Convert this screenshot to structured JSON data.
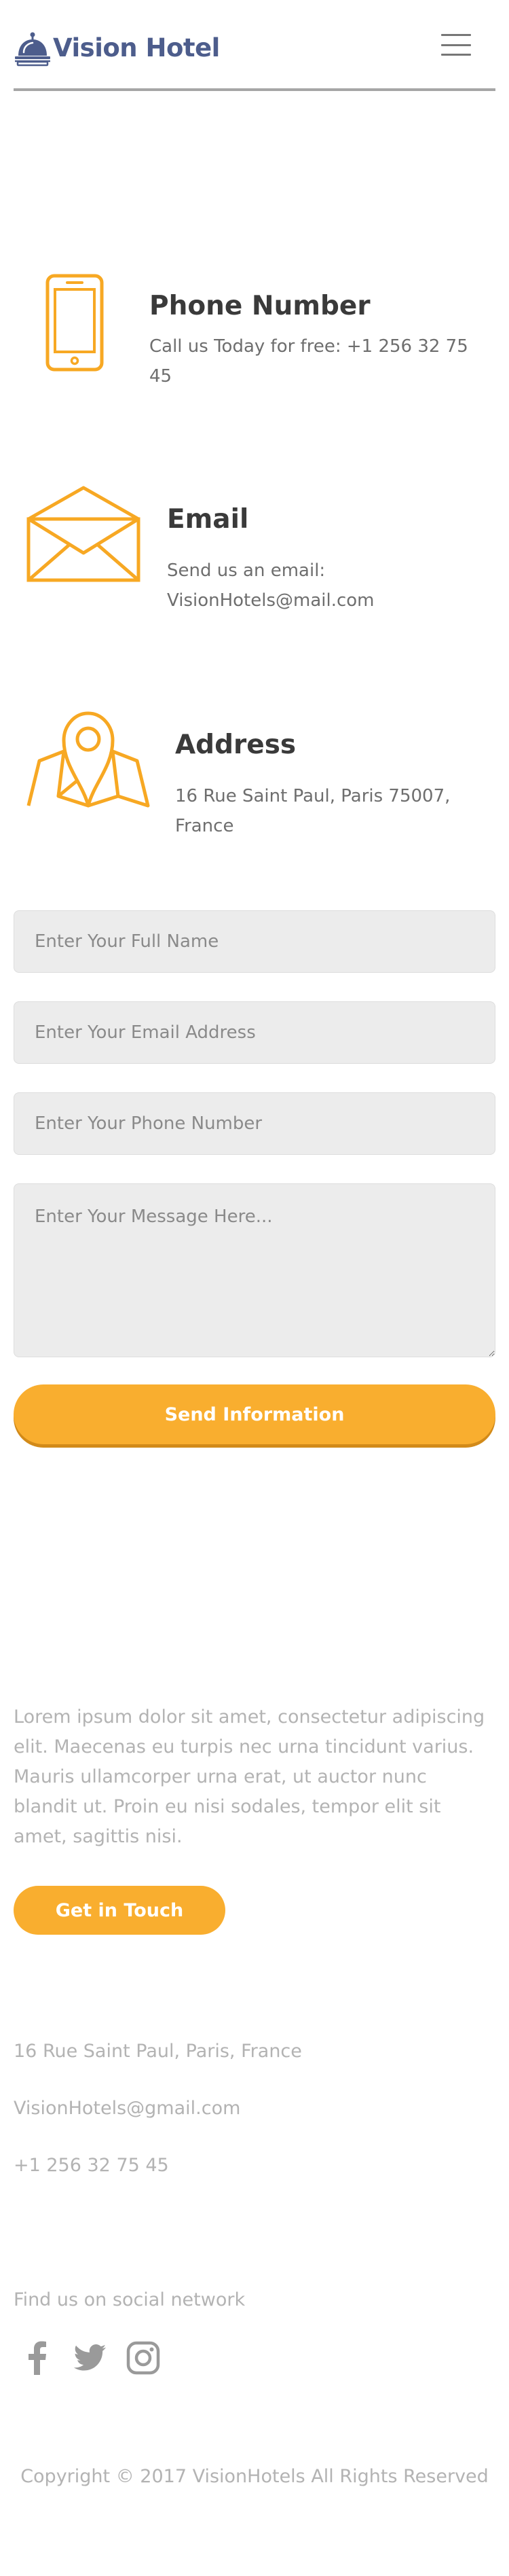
{
  "colors": {
    "brand": "#4d5d8c",
    "accent": "#f9ae2f",
    "heading": "#3a3a3a",
    "muted": "#b3b3b3"
  },
  "header": {
    "logo_text": "Vision Hotel",
    "logo_icon": "service-bell-icon",
    "menu_icon": "hamburger-menu-icon"
  },
  "contact": {
    "phone": {
      "icon": "smartphone-icon",
      "title": "Phone Number",
      "text": "Call us Today for free: +1 256 32 75 45"
    },
    "email": {
      "icon": "envelope-icon",
      "title": "Email",
      "text": "Send us an email: VisionHotels@mail.com"
    },
    "address": {
      "icon": "map-pin-icon",
      "title": "Address",
      "text": "16 Rue Saint Paul, Paris 75007, France"
    }
  },
  "form": {
    "name_placeholder": "Enter Your Full Name",
    "email_placeholder": "Enter Your Email Address",
    "phone_placeholder": "Enter Your Phone Number",
    "message_placeholder": "Enter Your Message Here...",
    "submit_label": "Send Information"
  },
  "footer": {
    "about": "Lorem ipsum dolor sit amet, consectetur adipiscing elit. Maecenas eu turpis nec urna tincidunt varius. Mauris ullamcorper urna erat, ut auctor nunc blandit ut. Proin eu nisi sodales, tempor elit sit amet, sagittis nisi.",
    "touch_label": "Get in Touch",
    "address": "16 Rue Saint Paul, Paris, France",
    "email": "VisionHotels@gmail.com",
    "phone": "+1 256 32 75 45",
    "social_heading": "Find us on social network",
    "social": [
      "facebook-icon",
      "twitter-icon",
      "instagram-icon"
    ],
    "copyright": "Copyright © 2017 VisionHotels All Rights Reserved"
  }
}
